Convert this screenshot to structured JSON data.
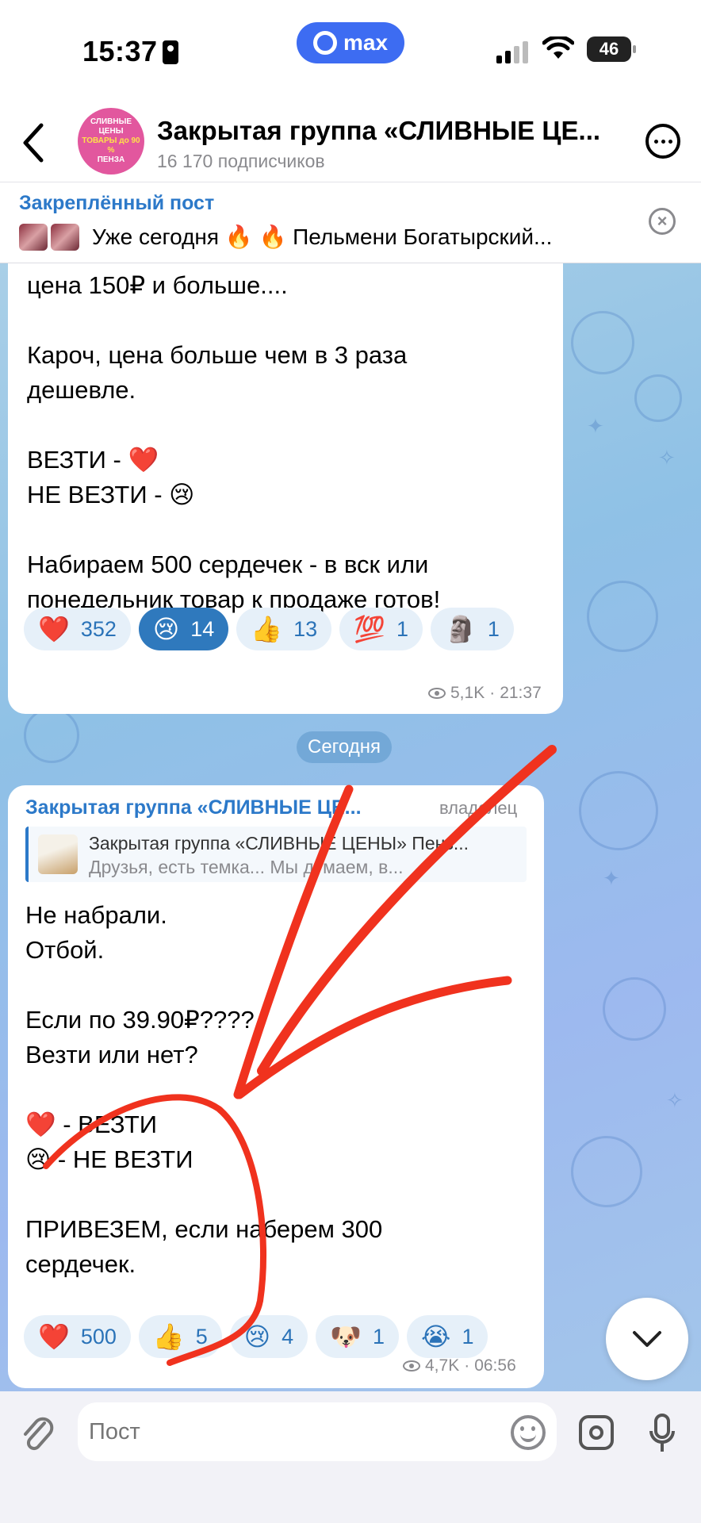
{
  "status_bar": {
    "time": "15:37",
    "app_pill": "max",
    "battery": "46"
  },
  "header": {
    "title": "Закрытая группа «СЛИВНЫЕ ЦЕ...",
    "subtitle": "16 170 подписчиков",
    "avatar_lines": [
      "СЛИВНЫЕ ЦЕНЫ",
      "ТОВАРЫ до 90 %",
      "ПЕНЗА"
    ]
  },
  "pinned": {
    "label": "Закреплённый пост",
    "text": "Уже сегодня 🔥 🔥 Пельмени Богатырский..."
  },
  "messages": [
    {
      "text": "цена 150₽ и больше....\n\nКароч, цена больше чем в 3 раза\nдешевле.\n\nВЕЗТИ - ❤️\nНЕ ВЕЗТИ - 😢\n\nНабираем 500 сердечек - в вск или\nпонедельник товар к продаже готов!",
      "reactions": [
        {
          "emoji": "❤️",
          "count": "352"
        },
        {
          "emoji": "😢",
          "count": "14",
          "active": true
        },
        {
          "emoji": "👍",
          "count": "13"
        },
        {
          "emoji": "💯",
          "count": "1"
        },
        {
          "emoji": "🗿",
          "count": "1"
        }
      ],
      "views": "5,1K",
      "time": "21:37"
    },
    {
      "sender": "Закрытая группа «СЛИВНЫЕ ЦЕ...",
      "role": "владелец",
      "quote_title": "Закрытая группа «СЛИВНЫЕ ЦЕНЫ» Пенз...",
      "quote_body": "Друзья, есть темка... Мы думаем, в...",
      "text": "Не набрали.\nОтбой.\n\nЕсли по 39.90₽????\nВезти или нет?\n\n❤️  - ВЕЗТИ\n😢  - НЕ ВЕЗТИ\n\nПРИВЕЗЕМ, если наберем 300\nсердечек.",
      "reactions": [
        {
          "emoji": "❤️",
          "count": "500"
        },
        {
          "emoji": "👍",
          "count": "5"
        },
        {
          "emoji": "😢",
          "count": "4"
        },
        {
          "emoji": "🐶",
          "count": "1"
        },
        {
          "emoji": "😭",
          "count": "1"
        }
      ],
      "views": "4,7K",
      "time": "06:56"
    }
  ],
  "date_separator": "Сегодня",
  "input": {
    "placeholder": "Пост"
  }
}
